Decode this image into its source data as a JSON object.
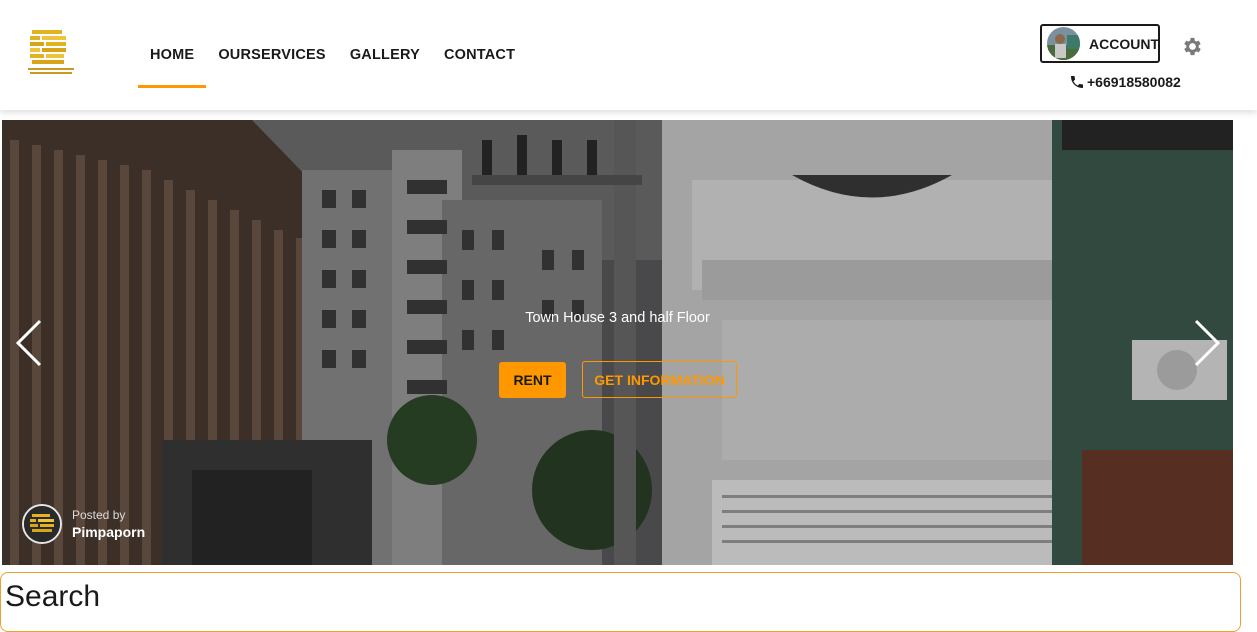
{
  "header": {
    "nav": [
      {
        "label": "HOME",
        "active": true
      },
      {
        "label": "OURSERVICES",
        "active": false
      },
      {
        "label": "GALLERY",
        "active": false
      },
      {
        "label": "CONTACT",
        "active": false
      }
    ],
    "account_label": "ACCOUNT",
    "phone": "+66918580082",
    "accent_color": "#ff9800"
  },
  "hero": {
    "caption": "Town House 3 and half Floor",
    "rent_label": "RENT",
    "info_label": "GET INFORMATION",
    "posted_label": "Posted by",
    "posted_name": "Pimpaporn"
  },
  "search": {
    "title": "Search"
  },
  "icons": [
    "company-logo",
    "user-avatar",
    "gear-icon",
    "phone-icon",
    "chevron-left-icon",
    "chevron-right-icon"
  ]
}
